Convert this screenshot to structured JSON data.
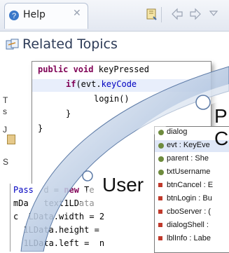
{
  "help_view": {
    "tab_label": "Help",
    "close_glyph": "✕",
    "toolbar_icons": [
      "bookmark-icon",
      "back-arrow-icon",
      "forward-arrow-icon",
      "view-menu-icon"
    ],
    "section_title": "Related Topics",
    "side_text": [
      "T",
      "s",
      "J",
      "S"
    ]
  },
  "code_editor": {
    "lines": [
      {
        "kw": "public void ",
        "text": "keyPressed"
      },
      {
        "kw": "if",
        "text": "(evt.",
        "field": "keyCode"
      },
      {
        "text": "login()"
      },
      {
        "text": "}"
      },
      {
        "text": "}"
      }
    ]
  },
  "code_strip": {
    "lines": [
      {
        "field": "Pass",
        "text": "  d = ",
        "kw": "new",
        "after": " Te"
      },
      {
        "text": "mDa   text1LData"
      },
      {
        "text": "c  LData.width = 2"
      },
      {
        "text": "  1LData.height ="
      },
      {
        "text": "  1LData.left =  n"
      }
    ]
  },
  "completion_list": {
    "items": [
      {
        "label": "dialog",
        "icon": "field-icon",
        "selected": false
      },
      {
        "label": "evt : KeyEve",
        "icon": "parameter-icon",
        "selected": true
      },
      {
        "label": "parent : She",
        "icon": "field-icon",
        "selected": false
      },
      {
        "label": "txtUsername",
        "icon": "field-icon",
        "selected": false
      },
      {
        "label": "btnCancel : E",
        "icon": "private-field-icon",
        "selected": false
      },
      {
        "label": "btnLogin : Bu",
        "icon": "private-field-icon",
        "selected": false
      },
      {
        "label": "cboServer : (",
        "icon": "private-field-icon",
        "selected": false
      },
      {
        "label": "dialogShell :",
        "icon": "private-field-icon",
        "selected": false
      },
      {
        "label": "lblInfo : Labe",
        "icon": "private-field-icon",
        "selected": false
      }
    ]
  },
  "overlay": {
    "text_user": "User",
    "text_p": "P",
    "text_c": "C"
  },
  "colors": {
    "keyword": "#7f0055",
    "field": "#0000c0",
    "private_field_icon": "#c0392b",
    "field_icon": "#6e8b3d",
    "swoosh": "#6f8db8"
  }
}
